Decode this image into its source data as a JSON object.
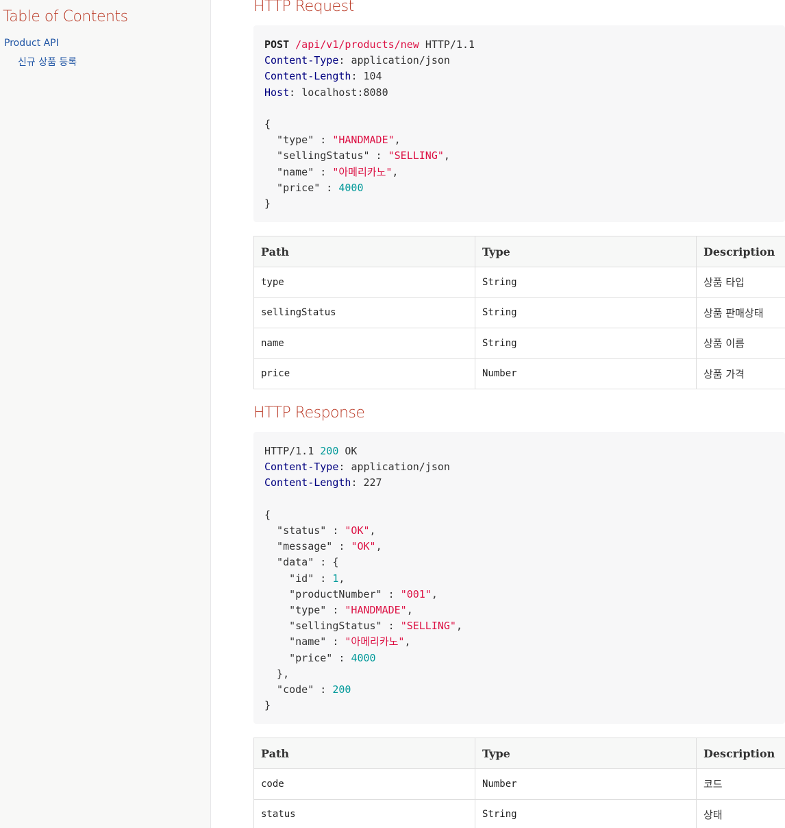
{
  "toc": {
    "title": "Table of Contents",
    "items": [
      {
        "label": "Product API"
      },
      {
        "label": "신규 상품 등록"
      }
    ]
  },
  "request": {
    "heading": "HTTP Request",
    "method": "POST",
    "path": "/api/v1/products/new",
    "protocol": "HTTP/1.1",
    "headers": [
      {
        "name": "Content-Type",
        "value": "application/json"
      },
      {
        "name": "Content-Length",
        "value": "104"
      },
      {
        "name": "Host",
        "value": "localhost:8080"
      }
    ],
    "body": {
      "type": "\"HANDMADE\"",
      "sellingStatus": "\"SELLING\"",
      "name": "\"아메리카노\"",
      "price": "4000"
    },
    "fields_table": {
      "columns": [
        "Path",
        "Type",
        "Description"
      ],
      "rows": [
        {
          "path": "type",
          "type": "String",
          "description": "상품 타입"
        },
        {
          "path": "sellingStatus",
          "type": "String",
          "description": "상품 판매상태"
        },
        {
          "path": "name",
          "type": "String",
          "description": "상품 이름"
        },
        {
          "path": "price",
          "type": "Number",
          "description": "상품 가격"
        }
      ]
    }
  },
  "response": {
    "heading": "HTTP Response",
    "protocol": "HTTP/1.1",
    "status_code": "200",
    "status_text": "OK",
    "headers": [
      {
        "name": "Content-Type",
        "value": "application/json"
      },
      {
        "name": "Content-Length",
        "value": "227"
      }
    ],
    "body": {
      "status": "\"OK\"",
      "message": "\"OK\"",
      "data": {
        "id": "1",
        "productNumber": "\"001\"",
        "type": "\"HANDMADE\"",
        "sellingStatus": "\"SELLING\"",
        "name": "\"아메리카노\"",
        "price": "4000"
      },
      "code": "200"
    },
    "fields_table": {
      "columns": [
        "Path",
        "Type",
        "Description"
      ],
      "rows": [
        {
          "path": "code",
          "type": "Number",
          "description": "코드"
        },
        {
          "path": "status",
          "type": "String",
          "description": "상태"
        }
      ]
    }
  },
  "colors": {
    "heading": "#ba3925",
    "link": "#2156a5",
    "json_string": "#dd1144",
    "json_number": "#009999",
    "http_header_name": "#000080",
    "listing_bg": "#f7f7f8",
    "sidebar_bg": "#f8f8f7"
  }
}
